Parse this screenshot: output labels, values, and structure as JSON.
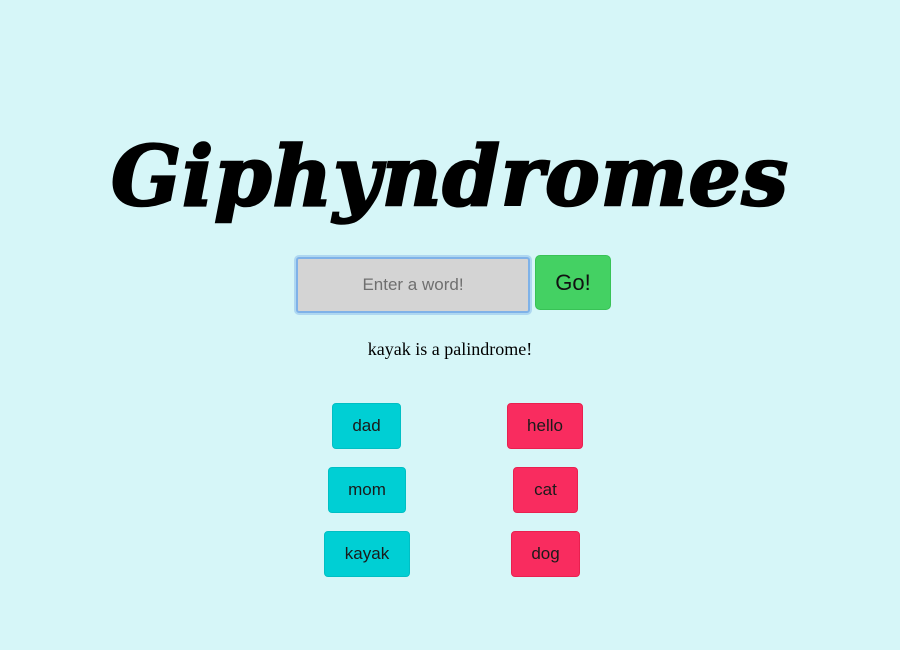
{
  "title": "Giphyndromes",
  "search": {
    "placeholder": "Enter a word!",
    "value": "",
    "go_label": "Go!"
  },
  "result_text": "kayak is a palindrome!",
  "palindromes": [
    {
      "label": "dad"
    },
    {
      "label": "mom"
    },
    {
      "label": "kayak"
    }
  ],
  "non_palindromes": [
    {
      "label": "hello"
    },
    {
      "label": "cat"
    },
    {
      "label": "dog"
    }
  ],
  "colors": {
    "background": "#d6f6f8",
    "palindrome_button": "#00cfd4",
    "non_palindrome_button": "#f92c5f",
    "go_button": "#44d163",
    "input_background": "#d4d4d4",
    "input_focus_border": "#7fb2e8"
  }
}
